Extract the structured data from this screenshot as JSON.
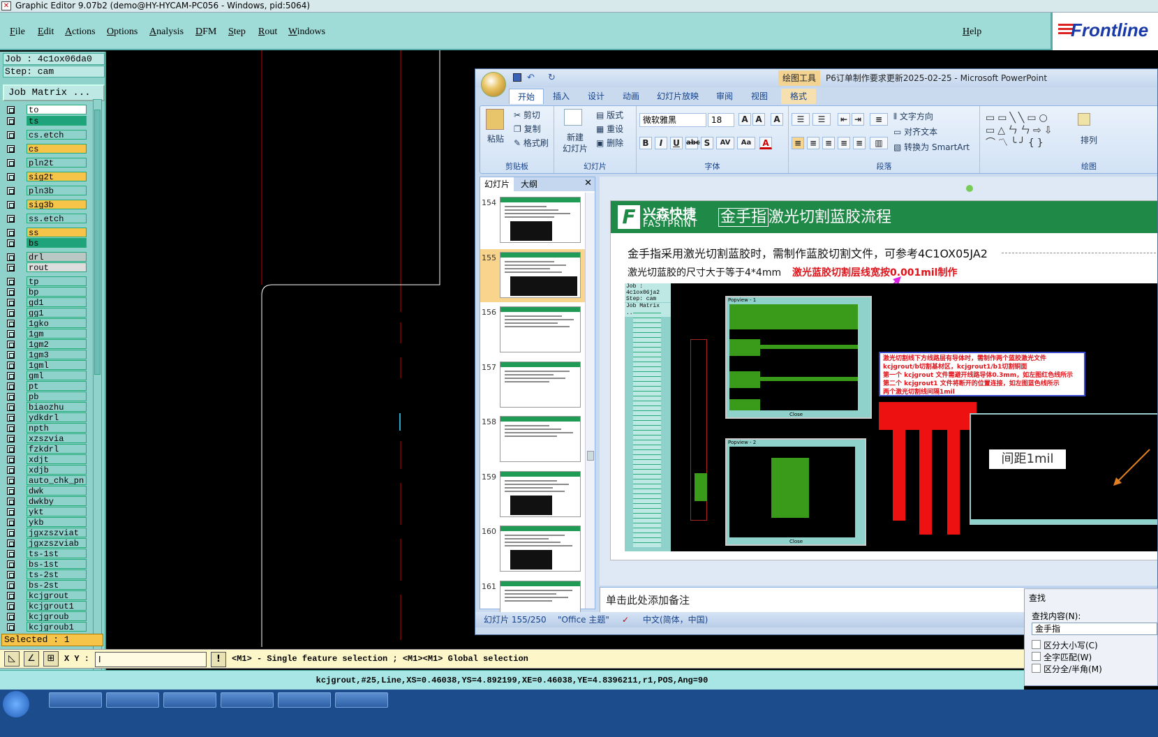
{
  "window": {
    "title": "Graphic Editor 9.07b2 (demo@HY-HYCAM-PC056 - Windows, pid:5064)"
  },
  "menu": {
    "items": [
      "File",
      "Edit",
      "Actions",
      "Options",
      "Analysis",
      "DFM",
      "Step",
      "Rout",
      "Windows"
    ],
    "help": "Help",
    "logo": "Frontline"
  },
  "left_panel": {
    "job": "Job : 4c1ox06da0",
    "step": "Step: cam",
    "job_matrix": "Job Matrix ...",
    "selected": "Selected : 1",
    "layers": [
      {
        "name": "to",
        "color": "#ffffff"
      },
      {
        "name": "ts",
        "color": "#1ea37a"
      },
      {
        "name": "cs.etch",
        "color": "#8fd2cc"
      },
      {
        "name": "cs",
        "color": "#f7c44a"
      },
      {
        "name": "pln2t",
        "color": "#8fd2cc"
      },
      {
        "name": "sig2t",
        "color": "#f7c44a"
      },
      {
        "name": "pln3b",
        "color": "#8fd2cc"
      },
      {
        "name": "sig3b",
        "color": "#f7c44a"
      },
      {
        "name": "ss.etch",
        "color": "#8fd2cc"
      },
      {
        "name": "ss",
        "color": "#f7c44a"
      },
      {
        "name": "bs",
        "color": "#1ea37a"
      },
      {
        "name": "drl",
        "color": "#b9c7c5"
      },
      {
        "name": "rout",
        "color": "#dddddd"
      },
      {
        "name": "tp",
        "color": "#8fd2cc"
      },
      {
        "name": "bp",
        "color": "#8fd2cc"
      },
      {
        "name": "gd1",
        "color": "#8fd2cc"
      },
      {
        "name": "gg1",
        "color": "#8fd2cc"
      },
      {
        "name": "1gko",
        "color": "#8fd2cc"
      },
      {
        "name": "1gm",
        "color": "#8fd2cc"
      },
      {
        "name": "1gm2",
        "color": "#8fd2cc"
      },
      {
        "name": "1gm3",
        "color": "#8fd2cc"
      },
      {
        "name": "1gml",
        "color": "#8fd2cc"
      },
      {
        "name": "gml",
        "color": "#8fd2cc"
      },
      {
        "name": "pt",
        "color": "#8fd2cc"
      },
      {
        "name": "pb",
        "color": "#8fd2cc"
      },
      {
        "name": "biaozhu",
        "color": "#8fd2cc"
      },
      {
        "name": "ydkdrl",
        "color": "#8fd2cc"
      },
      {
        "name": "npth",
        "color": "#8fd2cc"
      },
      {
        "name": "xzszvia",
        "color": "#8fd2cc"
      },
      {
        "name": "fzkdrl",
        "color": "#8fd2cc"
      },
      {
        "name": "xdjt",
        "color": "#8fd2cc"
      },
      {
        "name": "xdjb",
        "color": "#8fd2cc"
      },
      {
        "name": "auto_chk_pn",
        "color": "#8fd2cc"
      },
      {
        "name": "dwk",
        "color": "#8fd2cc"
      },
      {
        "name": "dwkby",
        "color": "#8fd2cc"
      },
      {
        "name": "ykt",
        "color": "#8fd2cc"
      },
      {
        "name": "ykb",
        "color": "#8fd2cc"
      },
      {
        "name": "jgxzszviat",
        "color": "#8fd2cc"
      },
      {
        "name": "jgxzszviab",
        "color": "#8fd2cc"
      },
      {
        "name": "ts-1st",
        "color": "#8fd2cc"
      },
      {
        "name": "bs-1st",
        "color": "#8fd2cc"
      },
      {
        "name": "ts-2st",
        "color": "#8fd2cc"
      },
      {
        "name": "bs-2st",
        "color": "#8fd2cc"
      },
      {
        "name": "kcjgrout",
        "color": "#8fd2cc"
      },
      {
        "name": "kcjgrout1",
        "color": "#8fd2cc"
      },
      {
        "name": "kcjgroub",
        "color": "#8fd2cc"
      },
      {
        "name": "kcjgroub1",
        "color": "#8fd2cc"
      }
    ]
  },
  "powerpoint": {
    "context_tab": "绘图工具",
    "doc_title": "P6订单制作要求更新2025-02-25 - Microsoft PowerPoint",
    "tabs": [
      "开始",
      "插入",
      "设计",
      "动画",
      "幻灯片放映",
      "审阅",
      "视图",
      "格式"
    ],
    "clipboard": {
      "paste": "粘贴",
      "cut": "剪切",
      "copy": "复制",
      "format_painter": "格式刷",
      "label": "剪贴板"
    },
    "slides_group": {
      "new": "新建",
      "new2": "幻灯片",
      "layout": "版式",
      "reset": "重设",
      "delete": "删除",
      "label": "幻灯片"
    },
    "font_group": {
      "font": "微软雅黑",
      "size": "18",
      "label": "字体"
    },
    "para_group": {
      "text_dir": "文字方向",
      "align_text": "对齐文本",
      "smartart": "转换为 SmartArt",
      "label": "段落"
    },
    "drawing_group": {
      "label": "绘图",
      "arrange": "排列"
    },
    "pane_tabs": [
      "幻灯片",
      "大纲"
    ],
    "slide_numbers": [
      "154",
      "155",
      "156",
      "157",
      "158",
      "159",
      "160",
      "161"
    ],
    "slide": {
      "logo_cn": "兴森快捷",
      "logo_en": "FASTPRINT",
      "title_a": "金手指",
      "title_b": "激光切割蓝胶流程",
      "line1": "金手指采用激光切割蓝胶时，需制作蓝胶切割文件，可参考4C1OX05JA2",
      "line2": "激光切蓝胶的尺寸大于等于4*4mm",
      "line2_red": "激光蓝胶切割层线宽按0.001mil制作",
      "note_red": [
        "激光切割线下方线路层有导体时，需制作两个蓝胶激光文件",
        "kcjgrout/b切割基材区，kcjgrout1/b1切割铜面",
        "第一个 kcjgrout 文件需避开线路导体0.3mm，如左图红色线所示",
        "第二个 kcjgrout1 文件将断开的位置连接，如左图蓝色线所示",
        "两个激光切割线间隔1mil"
      ],
      "gap_label": "间距1mil",
      "popview1": "Popview - 1",
      "popview2": "Popview - 2",
      "close": "Close",
      "mini_job": "Job : 4c1ox06ja2",
      "mini_step": "Step: cam",
      "mini_matrix": "Job Matrix ..."
    },
    "notes_placeholder": "单击此处添加备注",
    "status": {
      "slide": "幻灯片 155/250",
      "theme": "\"Office 主题\"",
      "lang": "中文(简体，中国)"
    }
  },
  "find_dialog": {
    "title": "查找",
    "label": "查找内容(N):",
    "value": "金手指",
    "opt1": "区分大小写(C)",
    "opt2": "全字匹配(W)",
    "opt3": "区分全/半角(M)"
  },
  "command_bar": {
    "xy_label": "X Y :",
    "hint": "<M1> - Single feature selection ; <M1><M1> Global selection"
  },
  "info_bar": {
    "text": "kcjgrout,#25,Line,XS=0.46038,YS=4.892199,XE=0.46038,YE=4.8396211,r1,POS,Ang=90"
  }
}
